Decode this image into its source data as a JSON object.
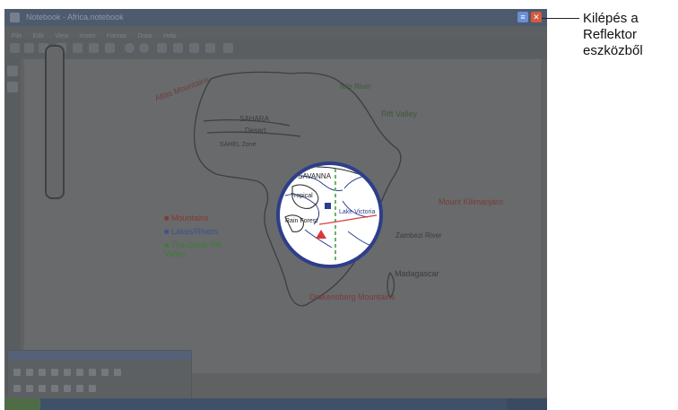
{
  "callout": {
    "lines": [
      "Kilépés a",
      "Reflektor",
      "eszközből"
    ]
  },
  "window": {
    "title": "Notebook - Africa.notebook"
  },
  "menu": {
    "items": [
      "File",
      "Edit",
      "View",
      "Insert",
      "Format",
      "Draw",
      "Help"
    ]
  },
  "map": {
    "labels": {
      "sahara": "SAHARA",
      "desert": "Desert",
      "sahel": "SAHEL Zone",
      "savanna": "SAVANNA",
      "tropical": "Tropical",
      "forest": "Rain Forest",
      "nile": "Nile River",
      "victoria": "Lake Victoria",
      "zambezi": "Zambezi River",
      "madagascar": "Madagascar",
      "atlas": "Atlas Mountains",
      "rift": "Rift Valley",
      "kilimanjaro": "Mount Kilimanjaro",
      "drakensberg": "Drakensberg Mountains"
    },
    "legend": [
      {
        "text": "Mountains",
        "color": "#8a3434"
      },
      {
        "text": "Lakes/Rivers",
        "color": "#3f5190"
      },
      {
        "text": "The Great Rift Valley",
        "color": "#3f7a3a"
      }
    ]
  },
  "colors": {
    "overlay": "#5f6163",
    "titlebar": "#4e5a6e",
    "lens_border": "#2d3e8a",
    "close": "#d35b3f",
    "help": "#6b8fd4"
  }
}
